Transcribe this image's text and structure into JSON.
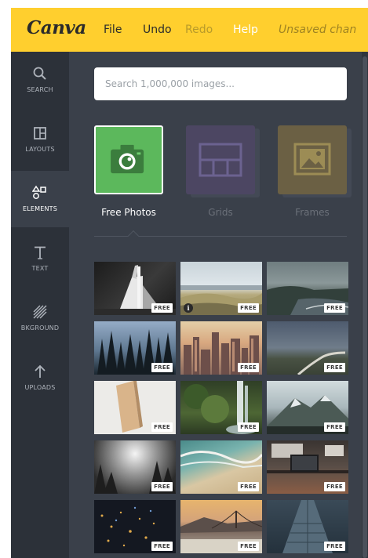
{
  "topbar": {
    "logo": "Canva",
    "menu": [
      {
        "label": "File"
      },
      {
        "label": "Undo"
      },
      {
        "label": "Redo"
      },
      {
        "label": "Help"
      }
    ],
    "status": "Unsaved chan"
  },
  "leftnav": {
    "items": [
      {
        "label": "SEARCH",
        "icon": "search-icon"
      },
      {
        "label": "LAYOUTS",
        "icon": "layouts-icon"
      },
      {
        "label": "ELEMENTS",
        "icon": "elements-icon",
        "active": true
      },
      {
        "label": "TEXT",
        "icon": "text-icon"
      },
      {
        "label": "BKGROUND",
        "icon": "background-icon"
      },
      {
        "label": "UPLOADS",
        "icon": "upload-icon"
      }
    ]
  },
  "search": {
    "placeholder": "Search 1,000,000 images..."
  },
  "categories": [
    {
      "label": "Free Photos",
      "icon": "camera-icon",
      "selected": true,
      "color": "#5cb85c"
    },
    {
      "label": "Grids",
      "icon": "grid-icon",
      "selected": false,
      "color": "#5b4f84"
    },
    {
      "label": "Frames",
      "icon": "frame-icon",
      "selected": false,
      "color": "#8b7a3c"
    }
  ],
  "photos": {
    "badge": "FREE",
    "info": "i",
    "items": [
      {
        "subject": "architecture-bw"
      },
      {
        "subject": "beach-dunes"
      },
      {
        "subject": "coastline"
      },
      {
        "subject": "pine-forest"
      },
      {
        "subject": "city-skyline"
      },
      {
        "subject": "road-landscape"
      },
      {
        "subject": "wooden-block"
      },
      {
        "subject": "waterfall"
      },
      {
        "subject": "mountain"
      },
      {
        "subject": "forest-fog"
      },
      {
        "subject": "ocean-waves"
      },
      {
        "subject": "desk-laptop"
      },
      {
        "subject": "city-night"
      },
      {
        "subject": "bridge-sunset"
      },
      {
        "subject": "skyscraper"
      }
    ]
  },
  "colors": {
    "accent": "#ffcf2e",
    "sidebar": "#2c3139",
    "panel": "#3a404a"
  }
}
